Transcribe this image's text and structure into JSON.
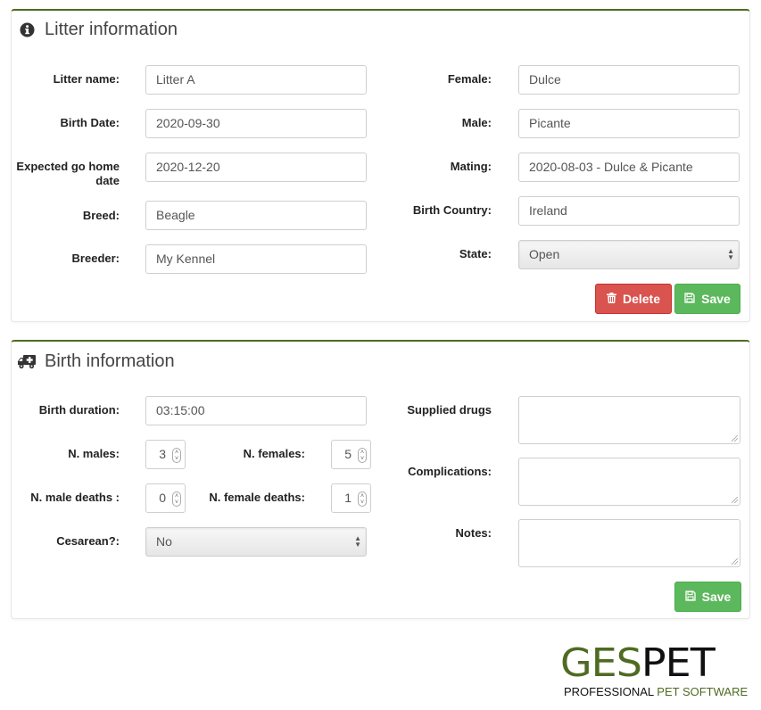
{
  "litter_panel": {
    "title": "Litter information",
    "icon": "info-circle-icon",
    "left_fields": [
      {
        "label": "Litter name:",
        "value": "Litter A"
      },
      {
        "label": "Birth Date:",
        "value": "2020-09-30"
      },
      {
        "label": "Expected go home date",
        "value": "2020-12-20"
      },
      {
        "label": "Breed:",
        "value": "Beagle"
      },
      {
        "label": "Breeder:",
        "value": "My Kennel"
      }
    ],
    "right_fields": [
      {
        "label": "Female:",
        "value": "Dulce"
      },
      {
        "label": "Male:",
        "value": "Picante"
      },
      {
        "label": "Mating:",
        "value": "2020-08-03 - Dulce & Picante"
      },
      {
        "label": "Birth Country:",
        "value": "Ireland"
      }
    ],
    "state": {
      "label": "State:",
      "value": "Open"
    },
    "delete_label": "Delete",
    "save_label": "Save"
  },
  "birth_panel": {
    "title": "Birth information",
    "icon": "ambulance-icon",
    "birth_duration": {
      "label": "Birth duration:",
      "value": "03:15:00"
    },
    "n_males": {
      "label": "N. males:",
      "value": "3"
    },
    "n_females": {
      "label": "N. females:",
      "value": "5"
    },
    "n_male_deaths": {
      "label": "N. male deaths :",
      "value": "0"
    },
    "n_female_deaths": {
      "label": "N. female deaths:",
      "value": "1"
    },
    "cesarean": {
      "label": "Cesarean?:",
      "value": "No"
    },
    "supplied_drugs": {
      "label": "Supplied drugs",
      "value": ""
    },
    "complications": {
      "label": "Complications:",
      "value": ""
    },
    "notes": {
      "label": "Notes:",
      "value": ""
    },
    "save_label": "Save"
  },
  "logo": {
    "brand_part1": "GES",
    "brand_part2": "PET",
    "tagline_part1": "PROFESSIONAL ",
    "tagline_part2": "PET SOFTWARE"
  },
  "colors": {
    "accent": "#4f6b22",
    "danger": "#d9534f",
    "success": "#5cb85c"
  }
}
